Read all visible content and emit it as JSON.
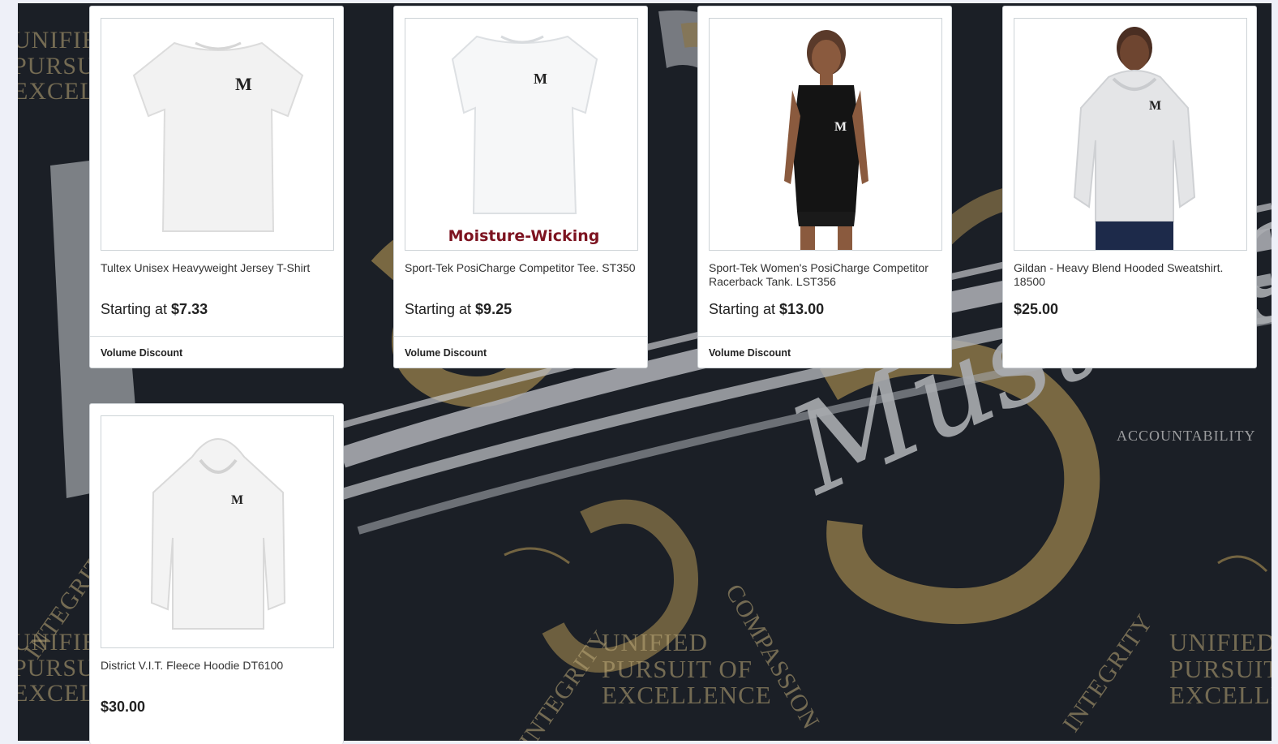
{
  "background": {
    "script_text": "Mustang",
    "motto_lines": [
      "UNIFIED",
      "PURSUIT OF",
      "EXCELLENCE"
    ],
    "words": [
      "INTEGRITY",
      "COMPASSION",
      "ACCOUNTABILITY"
    ],
    "colors": {
      "navy": "#1b1f26",
      "gold": "#8a7548",
      "silver": "#a9acb0"
    }
  },
  "products": [
    {
      "title": "Tultex Unisex Heavyweight Jersey T-Shirt",
      "price_prefix": "Starting at ",
      "price": "$7.33",
      "discount": "Volume Discount",
      "image": "tshirt-icon"
    },
    {
      "title": "Sport-Tek PosiCharge Competitor Tee. ST350",
      "price_prefix": "Starting at ",
      "price": "$9.25",
      "discount": "Volume Discount",
      "image": "performance-tee-icon",
      "image_caption": "Moisture-Wicking"
    },
    {
      "title": "Sport-Tek Women's PosiCharge Competitor Racerback Tank. LST356",
      "price_prefix": "Starting at ",
      "price": "$13.00",
      "discount": "Volume Discount",
      "image": "tank-model-icon"
    },
    {
      "title": "Gildan - Heavy Blend Hooded Sweatshirt. 18500",
      "price_prefix": "",
      "price": "$25.00",
      "discount": "",
      "image": "hoodie-model-icon"
    },
    {
      "title": "District V.I.T. Fleece Hoodie DT6100",
      "price_prefix": "",
      "price": "$30.00",
      "discount": "",
      "image": "hoodie-icon"
    }
  ],
  "logo_letter": "M"
}
